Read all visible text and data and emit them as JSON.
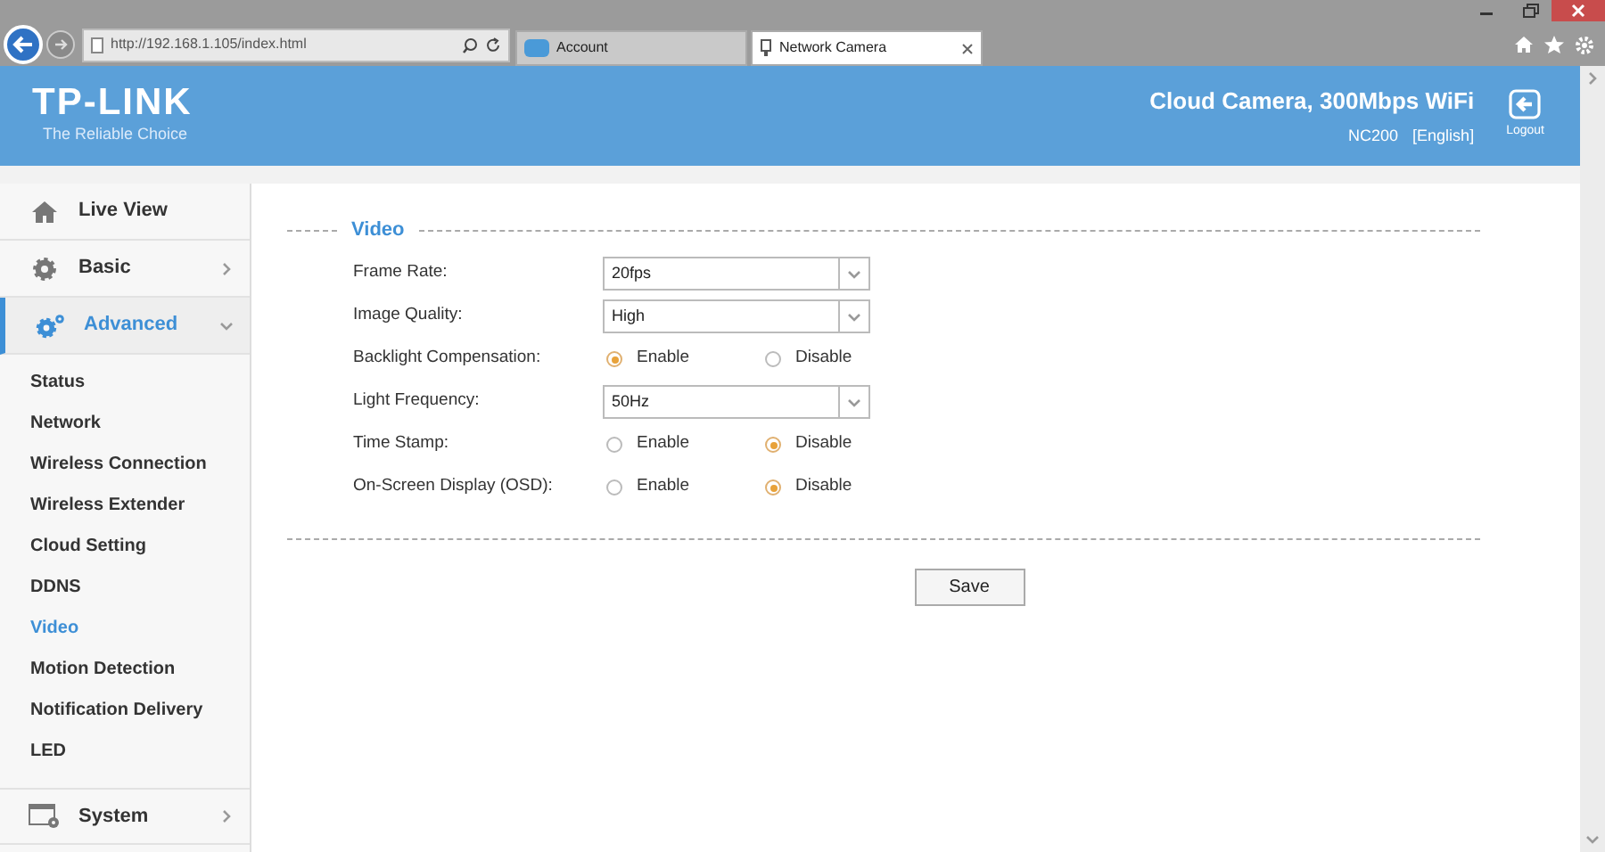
{
  "browser": {
    "address": "http://192.168.1.105/index.html",
    "tabs": [
      {
        "title": "Account",
        "selected": false
      },
      {
        "title": "Network Camera",
        "selected": true
      }
    ]
  },
  "header": {
    "brand": "TP-LINK",
    "tagline": "The Reliable Choice",
    "product": "Cloud Camera, 300Mbps WiFi",
    "model": "NC200",
    "language": "[English]",
    "logout": "Logout"
  },
  "sidebar": {
    "items": [
      {
        "label": "Live View",
        "selected": false
      },
      {
        "label": "Basic",
        "selected": false,
        "expanded": false
      },
      {
        "label": "Advanced",
        "selected": true,
        "expanded": true,
        "children": [
          {
            "label": "Status",
            "selected": false
          },
          {
            "label": "Network",
            "selected": false
          },
          {
            "label": "Wireless Connection",
            "selected": false
          },
          {
            "label": "Wireless Extender",
            "selected": false
          },
          {
            "label": "Cloud Setting",
            "selected": false
          },
          {
            "label": "DDNS",
            "selected": false
          },
          {
            "label": "Video",
            "selected": true
          },
          {
            "label": "Motion Detection",
            "selected": false
          },
          {
            "label": "Notification Delivery",
            "selected": false
          },
          {
            "label": "LED",
            "selected": false
          }
        ]
      },
      {
        "label": "System",
        "selected": false,
        "expanded": false
      }
    ]
  },
  "section": {
    "title": "Video",
    "fields": [
      {
        "kind": "select",
        "label": "Frame Rate:",
        "value": "20fps"
      },
      {
        "kind": "select",
        "label": "Image Quality:",
        "value": "High"
      },
      {
        "kind": "radio",
        "label": "Backlight Compensation:",
        "options": [
          {
            "label": "Enable",
            "selected": true
          },
          {
            "label": "Disable",
            "selected": false
          }
        ]
      },
      {
        "kind": "select",
        "label": "Light Frequency:",
        "value": "50Hz"
      },
      {
        "kind": "radio",
        "label": "Time Stamp:",
        "options": [
          {
            "label": "Enable",
            "selected": false
          },
          {
            "label": "Disable",
            "selected": true
          }
        ]
      },
      {
        "kind": "radio",
        "label": "On-Screen Display (OSD):",
        "options": [
          {
            "label": "Enable",
            "selected": false
          },
          {
            "label": "Disable",
            "selected": true
          }
        ]
      }
    ],
    "save": "Save"
  }
}
